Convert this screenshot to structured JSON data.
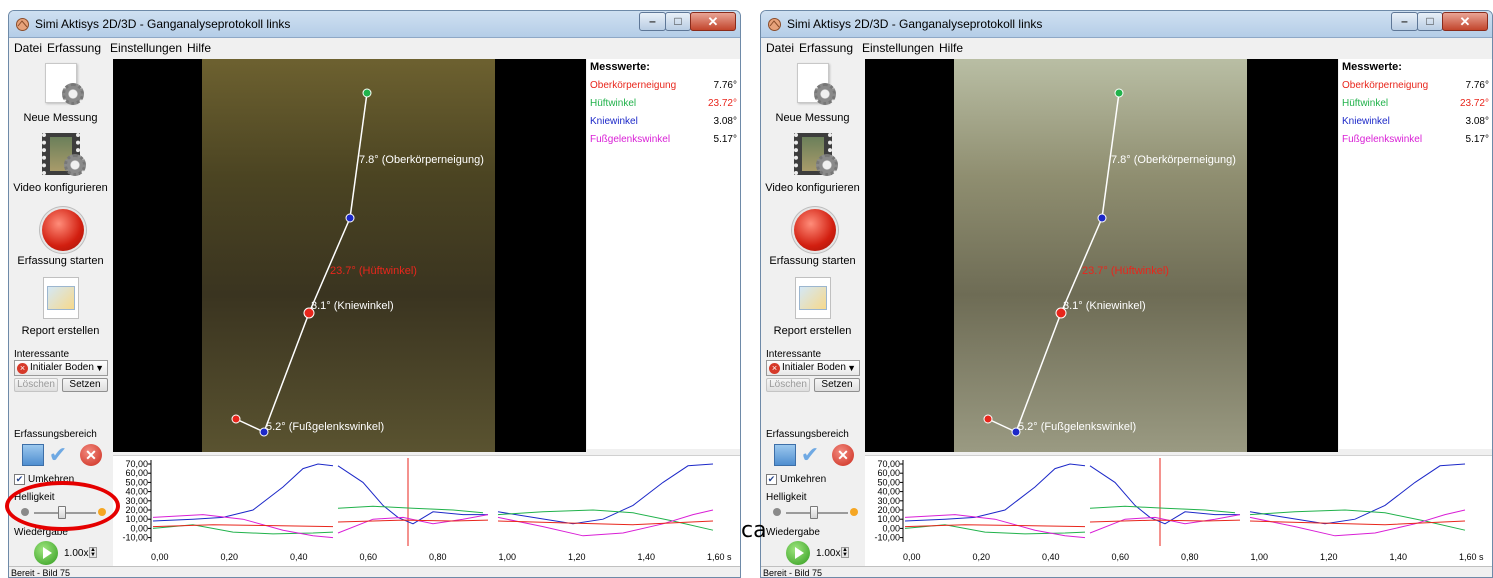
{
  "screens": {
    "window_title": "Simi Aktisys 2D/3D - Ganganalyseprotokoll links",
    "menu": [
      "Datei",
      "Erfassung",
      "Einstellungen",
      "Hilfe"
    ],
    "toolbar": {
      "new_measure": "Neue Messung",
      "video_config": "Video konfigurieren",
      "start_capture": "Erfassung starten",
      "report": "Report erstellen"
    },
    "interest": {
      "label": "Interessante",
      "combo_value": "Initialer Boden",
      "delete": "Löschen",
      "set": "Setzen"
    },
    "capture_area_label": "Erfassungsbereich",
    "invert_label": "Umkehren",
    "invert_checked": true,
    "brightness_label": "Helligkeit",
    "brightness_level": 0.45,
    "playback_label": "Wiedergabe",
    "playback_speed": "1.00x",
    "status": "Bereit - Bild 75",
    "measures": {
      "title": "Messwerte:",
      "rows": [
        {
          "name": "Oberkörperneigung",
          "value": "7.76°",
          "color": "#e8261c",
          "value_color": "#000000"
        },
        {
          "name": "Hüftwinkel",
          "value": "23.72°",
          "color": "#21b24b",
          "value_color": "#e8261c"
        },
        {
          "name": "Kniewinkel",
          "value": "3.08°",
          "color": "#1c28c8",
          "value_color": "#000000"
        },
        {
          "name": "Fußgelenkswinkel",
          "value": "5.17°",
          "color": "#d91fd6",
          "value_color": "#000000"
        }
      ]
    },
    "video_labels": {
      "trunk": "7.8° (Oberkörperneigung)",
      "hip": "23.7° (Hüftwinkel)",
      "knee": "3.1° (Kniewinkel)",
      "ankle": "5.2° (Fußgelenkswinkel)"
    },
    "chart_axis": {
      "y_ticks": [
        "70,00",
        "60,00",
        "50,00",
        "40,00",
        "30,00",
        "20,00",
        "10,00",
        "0,00",
        "-10,00"
      ],
      "x_ticks": [
        "0,00",
        "0,20",
        "0,40",
        "0,60",
        "0,80",
        "1,00",
        "1,20",
        "1,40",
        "1,60 s"
      ]
    }
  },
  "stray_text": "ca",
  "colors": {
    "red": "#e8261c",
    "green": "#21b24b",
    "blue": "#1c28c8",
    "magenta": "#d91fd6"
  }
}
